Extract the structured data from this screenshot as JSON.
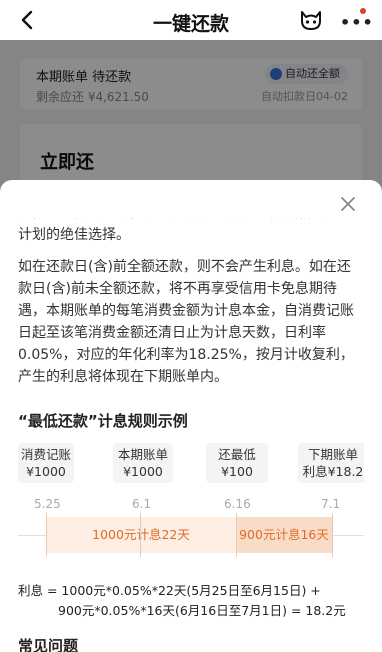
{
  "nav": {
    "title": "一键还款"
  },
  "bill": {
    "header": "本期账单  待还款",
    "remaining": "剩余应还 ¥4,621.50",
    "autopay_badge": "自动还全额",
    "autopay_date": "自动扣款日04-02"
  },
  "repay_card": {
    "title": "立即还"
  },
  "sheet": {
    "intro_partial": "用，剩余资金腾挪，是您灵活处理账务、灵活管理还款计划的绝佳选择。",
    "interest_rule": "如在还款日(含)前全额还款，则不会产生利息。如在还款日(含)前未全额还款，将不再享受信用卡免息期待遇，本期账单的每笔消费金额为计息本金，自消费记账日起至该笔消费金额还清日止为计息天数，日利率0.05%，对应的年化利率为18.25%，按月计收复利，产生的利息将体现在下期账单内。",
    "example_title": "“最低还款”计息规则示例",
    "timeline": {
      "cols": [
        {
          "label": "消费记账",
          "value": "¥1000"
        },
        {
          "label": "本期账单",
          "value": "¥1000"
        },
        {
          "label": "还最低",
          "value": "¥100"
        },
        {
          "label": "下期账单",
          "value": "利息¥18.2"
        }
      ],
      "dates": [
        "5.25",
        "6.1",
        "6.16",
        "7.1"
      ],
      "segments": [
        "1000元计息22天",
        "900元计息16天"
      ]
    },
    "formula_line1": "利息 = 1000元*0.05%*22天(5月25日至6月15日) +",
    "formula_line2": "900元*0.05%*16天(6月16日至7月1日) = 18.2元",
    "faq_title": "常见问题"
  },
  "colors": {
    "accent_orange": "#e06b2a",
    "segment_light": "#fdeee3",
    "segment_dark": "#f9dcc8",
    "autopay_blue": "#3a6fd8",
    "notify_red": "#e23a2e"
  },
  "icons": {
    "back": "chevron-left-icon",
    "mascot": "cat-mascot-icon",
    "more": "more-dots-icon",
    "close": "close-icon",
    "autopay": "autopay-icon"
  }
}
